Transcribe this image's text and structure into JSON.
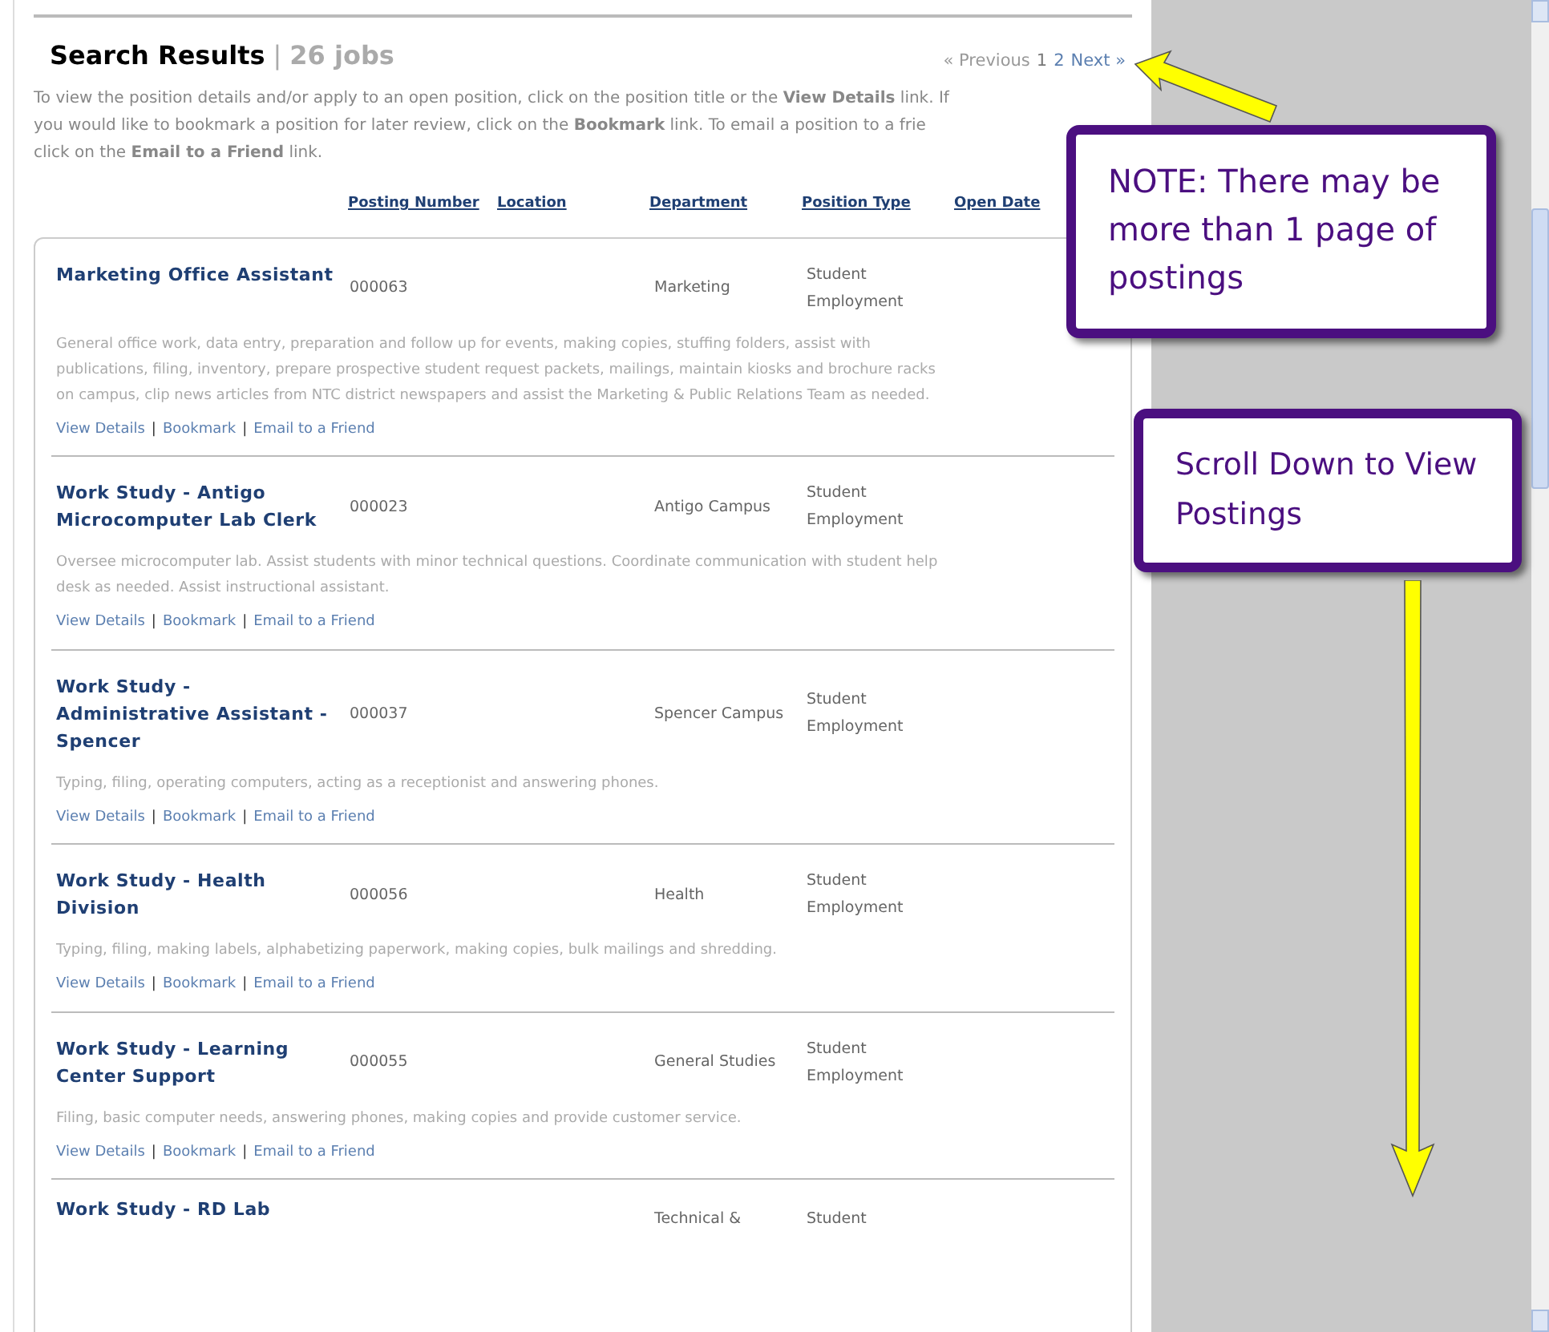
{
  "header": {
    "title": "Search Results",
    "separator": "|",
    "count": "26 jobs"
  },
  "pagination": [
    {
      "label": "« Previous",
      "kind": "inactive"
    },
    {
      "label": "1",
      "kind": "current"
    },
    {
      "label": "2",
      "kind": "link"
    },
    {
      "label": "Next »",
      "kind": "link"
    }
  ],
  "intro_lines": [
    "To view the position details and/or apply to an open position, click on the position title or the **View Details** link.  If",
    "you would like to bookmark a position for later review, click on the **Bookmark** link. To email a position to a frie",
    "click on the **Email to a Friend** link."
  ],
  "link_separator": "|",
  "columns": [
    "Posting Number",
    "Location",
    "Department",
    "Position Type",
    "Open Date"
  ],
  "postings": [
    {
      "title": "Marketing Office Assistant",
      "number": "000063",
      "department": "Marketing",
      "type": "Student Employment",
      "description": "General office work, data entry, preparation and follow up for events, making copies, stuffing folders, assist with publications, filing, inventory, prepare prospective student request packets, mailings, maintain kiosks and brochure racks on campus, clip news articles from NTC district newspapers and assist the Marketing & Public Relations Team as needed.",
      "links": [
        "View Details",
        "Bookmark",
        "Email to a Friend"
      ]
    },
    {
      "title": "Work Study - Antigo Microcomputer Lab Clerk",
      "number": "000023",
      "department": "Antigo Campus",
      "type": "Student Employment",
      "description": "Oversee microcomputer lab. Assist students with minor technical questions. Coordinate communication with student help desk as needed. Assist instructional assistant.",
      "links": [
        "View Details",
        "Bookmark",
        "Email to a Friend"
      ]
    },
    {
      "title": "Work Study - Administrative Assistant - Spencer",
      "number": "000037",
      "department": "Spencer Campus",
      "type": "Student Employment",
      "description": "Typing, filing, operating computers, acting as a receptionist and answering phones.",
      "links": [
        "View Details",
        "Bookmark",
        "Email to a Friend"
      ]
    },
    {
      "title": "Work Study - Health Division",
      "number": "000056",
      "department": "Health",
      "type": "Student Employment",
      "description": "Typing, filing, making labels, alphabetizing paperwork, making copies, bulk mailings and shredding.",
      "links": [
        "View Details",
        "Bookmark",
        "Email to a Friend"
      ]
    },
    {
      "title": "Work Study - Learning Center Support",
      "number": "000055",
      "department": "General Studies",
      "type": "Student Employment",
      "description": "Filing, basic computer needs, answering phones, making copies and provide customer service.",
      "links": [
        "View Details",
        "Bookmark",
        "Email to a Friend"
      ]
    }
  ],
  "last_posting": {
    "title": "Work Study - RD Lab",
    "department": "Technical &",
    "type": "Student"
  },
  "callouts": [
    "NOTE: There may be more than 1 page of postings",
    "Scroll Down to View Postings"
  ]
}
